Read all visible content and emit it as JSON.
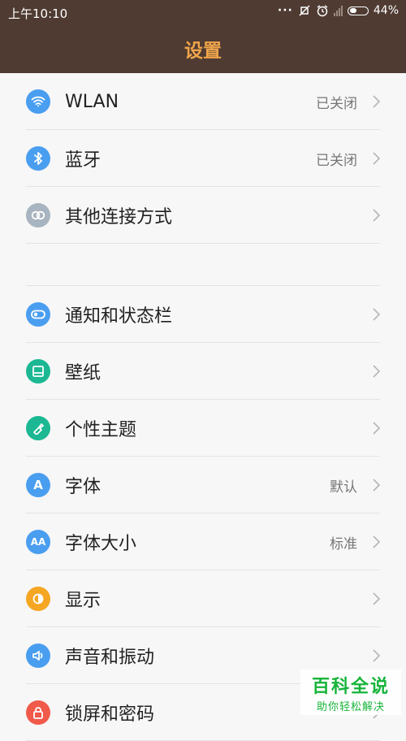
{
  "status": {
    "time": "上午10:10",
    "battery": "44%"
  },
  "header": {
    "title": "设置"
  },
  "group1": [
    {
      "label": "WLAN",
      "value": "已关闭",
      "icon": "wifi-icon",
      "color": "#4a9ef0"
    },
    {
      "label": "蓝牙",
      "value": "已关闭",
      "icon": "bluetooth-icon",
      "color": "#4a9ef0"
    },
    {
      "label": "其他连接方式",
      "value": "",
      "icon": "link-icon",
      "color": "#a8b4bf"
    }
  ],
  "group2": [
    {
      "label": "通知和状态栏",
      "value": "",
      "icon": "toggle-icon",
      "color": "#4a9ef0"
    },
    {
      "label": "壁纸",
      "value": "",
      "icon": "wallpaper-icon",
      "color": "#1bb893"
    },
    {
      "label": "个性主题",
      "value": "",
      "icon": "theme-brush-icon",
      "color": "#1bb893"
    },
    {
      "label": "字体",
      "value": "默认",
      "icon": "font-icon",
      "glyph": "A",
      "color": "#4a9ef0"
    },
    {
      "label": "字体大小",
      "value": "标准",
      "icon": "font-size-icon",
      "glyph": "AA",
      "color": "#4a9ef0"
    },
    {
      "label": "显示",
      "value": "",
      "icon": "display-icon",
      "color": "#f5a623"
    },
    {
      "label": "声音和振动",
      "value": "",
      "icon": "speaker-icon",
      "color": "#4a9ef0"
    },
    {
      "label": "锁屏和密码",
      "value": "",
      "icon": "lock-icon",
      "color": "#f05a4a"
    }
  ],
  "watermark": {
    "title": "百科全说",
    "subtitle": "助你轻松解决"
  }
}
